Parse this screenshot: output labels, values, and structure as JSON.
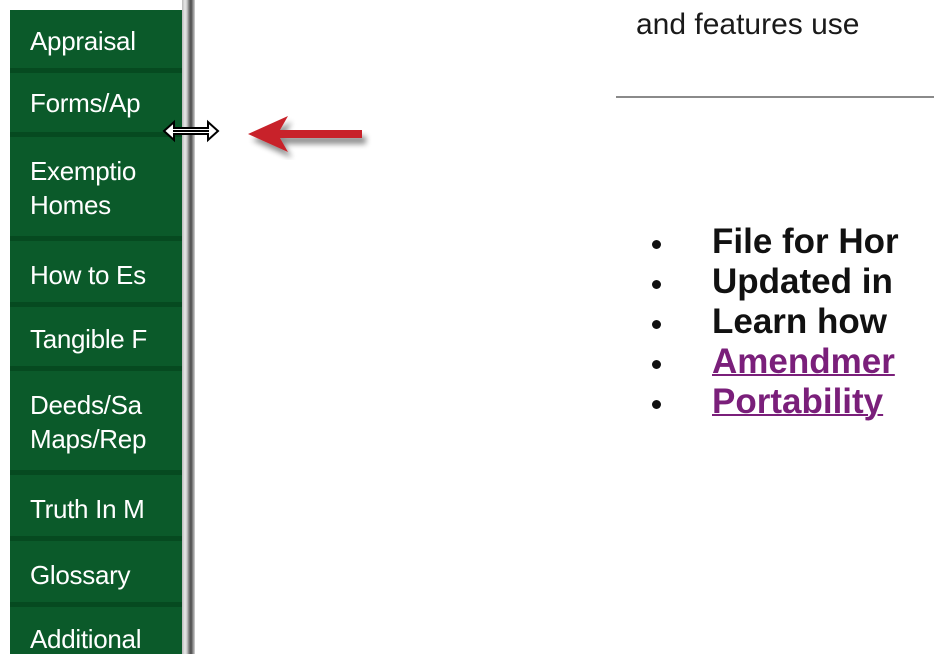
{
  "sidebar": {
    "items": [
      {
        "lines": [
          "Appraisal"
        ]
      },
      {
        "lines": [
          "Forms/Ap"
        ]
      },
      {
        "lines": [
          "Exemptio",
          "Homes"
        ]
      },
      {
        "lines": [
          "How to Es"
        ]
      },
      {
        "lines": [
          "Tangible F"
        ]
      },
      {
        "lines": [
          "Deeds/Sa",
          "Maps/Rep"
        ]
      },
      {
        "lines": [
          "Truth In M"
        ]
      },
      {
        "lines": [
          "Glossary"
        ]
      },
      {
        "lines": [
          "Additional"
        ]
      }
    ]
  },
  "main": {
    "top_text": "and features use",
    "bullets": [
      {
        "text": "File for Hor",
        "link": false
      },
      {
        "text": "Updated in",
        "link": false
      },
      {
        "text": "Learn how",
        "link": false
      },
      {
        "text": "Amendmer",
        "link": true
      },
      {
        "text": "Portability",
        "link": true
      }
    ]
  },
  "colors": {
    "sidebar_bg": "#0b5a2a",
    "link": "#7a1f7a",
    "arrow": "#c8232a"
  },
  "icons": {
    "splitter_cursor": "horizontal-resize-cursor-icon",
    "annotation": "red-left-arrow-icon"
  }
}
